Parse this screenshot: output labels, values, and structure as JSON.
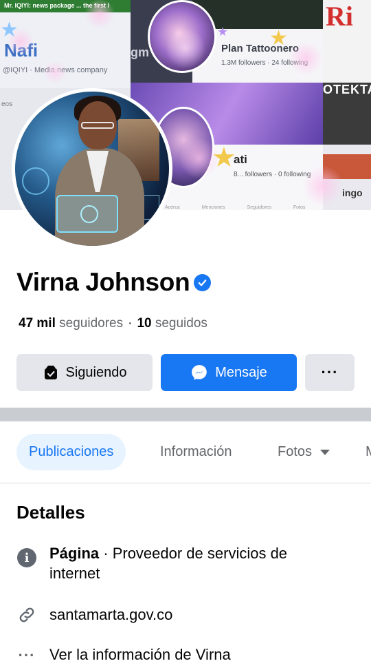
{
  "cover": {
    "header_strip": "Mr. IQIYI: news package ... the first l",
    "tile_a_name": "Nafi",
    "tile_a_sub": "@IQIYI · Media news company",
    "tile_b_label": "gm",
    "tile_d_name": "Plan Tattoonero",
    "tile_d_sub": "1.3M followers · 24 following",
    "tile_e_logo": "Ri",
    "tile_f_text": "eos",
    "tile_g2_text": "OTEKTA",
    "tile_h_name": "ati",
    "tile_h_sub": "8... followers · 0 following",
    "tile_h_nav": "Acerca Menciones Seguidores Fotos",
    "tile_i_text": "ingo"
  },
  "profile": {
    "name": "Virna Johnson",
    "followers_count": "47 mil",
    "followers_label": "seguidores",
    "separator": "·",
    "following_count": "10",
    "following_label": "seguidos"
  },
  "actions": {
    "following_label": "Siguiendo",
    "message_label": "Mensaje",
    "more_label": "···"
  },
  "tabs": [
    {
      "label": "Publicaciones",
      "active": true
    },
    {
      "label": "Información",
      "active": false
    },
    {
      "label": "Fotos",
      "active": false
    },
    {
      "label": "M",
      "active": false
    }
  ],
  "details": {
    "title": "Detalles",
    "category_bold": "Página",
    "category_rest": " · Proveedor de servicios de internet",
    "website": "santamarta.gov.co",
    "see_more": "Ver la información de Virna"
  },
  "colors": {
    "accent": "#1877f2",
    "button_gray": "#e4e6eb",
    "active_tab_bg": "#e7f3ff",
    "separator": "#c9ccd1"
  },
  "icons": {
    "verified": "verified-badge-icon",
    "following": "following-check-icon",
    "message": "messenger-icon",
    "info": "info-icon",
    "link": "link-icon",
    "more": "more-dots-icon",
    "caret": "caret-down-icon"
  }
}
